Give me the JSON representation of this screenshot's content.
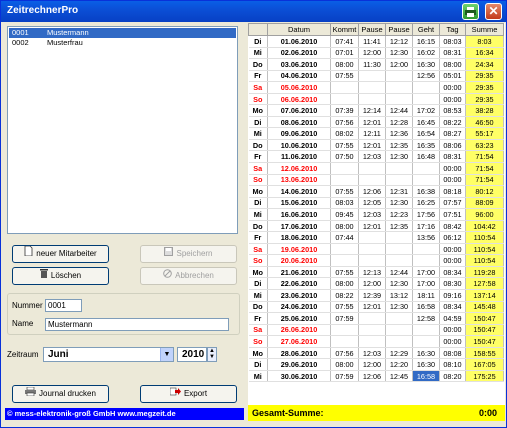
{
  "app": {
    "title": "ZeitrechnerPro",
    "close_glyph": "✕"
  },
  "employees": [
    {
      "number": "0001",
      "name": "Mustermann",
      "selected": true
    },
    {
      "number": "0002",
      "name": "Musterfrau",
      "selected": false
    }
  ],
  "buttons": {
    "new_employee": "neuer Mitarbeiter",
    "save": "Speichern",
    "delete": "Löschen",
    "cancel": "Abbrechen",
    "print_journal": "Journal drucken",
    "export": "Export"
  },
  "form": {
    "number_label": "Nummer",
    "number_value": "0001",
    "name_label": "Name",
    "name_value": "Mustermann",
    "period_label": "Zeitraum",
    "month_value": "Juni",
    "year_value": "2010"
  },
  "footer_left": "© mess-elektronik-groß GmbH   www.megzeit.de",
  "table": {
    "headers": [
      "",
      "Datum",
      "Kommt",
      "Pause",
      "Pause",
      "Geht",
      "Tag",
      "Summe"
    ],
    "rows": [
      [
        "Di",
        "01.06.2010",
        "07:41",
        "11:41",
        "12:12",
        "16:15",
        "08:03",
        "8:03"
      ],
      [
        "Mi",
        "02.06.2010",
        "07:01",
        "12:00",
        "12:30",
        "16:02",
        "08:31",
        "16:34"
      ],
      [
        "Do",
        "03.06.2010",
        "08:00",
        "11:30",
        "12:00",
        "16:30",
        "08:00",
        "24:34"
      ],
      [
        "Fr",
        "04.06.2010",
        "07:55",
        "",
        "",
        "12:56",
        "05:01",
        "29:35"
      ],
      [
        "Sa",
        "05.06.2010",
        "",
        "",
        "",
        "",
        "00:00",
        "29:35"
      ],
      [
        "So",
        "06.06.2010",
        "",
        "",
        "",
        "",
        "00:00",
        "29:35"
      ],
      [
        "Mo",
        "07.06.2010",
        "07:39",
        "12:14",
        "12:44",
        "17:02",
        "08:53",
        "38:28"
      ],
      [
        "Di",
        "08.06.2010",
        "07:56",
        "12:01",
        "12:28",
        "16:45",
        "08:22",
        "46:50"
      ],
      [
        "Mi",
        "09.06.2010",
        "08:02",
        "12:11",
        "12:36",
        "16:54",
        "08:27",
        "55:17"
      ],
      [
        "Do",
        "10.06.2010",
        "07:55",
        "12:01",
        "12:35",
        "16:35",
        "08:06",
        "63:23"
      ],
      [
        "Fr",
        "11.06.2010",
        "07:50",
        "12:03",
        "12:30",
        "16:48",
        "08:31",
        "71:54"
      ],
      [
        "Sa",
        "12.06.2010",
        "",
        "",
        "",
        "",
        "00:00",
        "71:54"
      ],
      [
        "So",
        "13.06.2010",
        "",
        "",
        "",
        "",
        "00:00",
        "71:54"
      ],
      [
        "Mo",
        "14.06.2010",
        "07:55",
        "12:06",
        "12:31",
        "16:38",
        "08:18",
        "80:12"
      ],
      [
        "Di",
        "15.06.2010",
        "08:03",
        "12:05",
        "12:30",
        "16:25",
        "07:57",
        "88:09"
      ],
      [
        "Mi",
        "16.06.2010",
        "09:45",
        "12:03",
        "12:23",
        "17:56",
        "07:51",
        "96:00"
      ],
      [
        "Do",
        "17.06.2010",
        "08:00",
        "12:01",
        "12:35",
        "17:16",
        "08:42",
        "104:42"
      ],
      [
        "Fr",
        "18.06.2010",
        "07:44",
        "",
        "",
        "13:56",
        "06:12",
        "110:54"
      ],
      [
        "Sa",
        "19.06.2010",
        "",
        "",
        "",
        "",
        "00:00",
        "110:54"
      ],
      [
        "So",
        "20.06.2010",
        "",
        "",
        "",
        "",
        "00:00",
        "110:54"
      ],
      [
        "Mo",
        "21.06.2010",
        "07:55",
        "12:13",
        "12:44",
        "17:00",
        "08:34",
        "119:28"
      ],
      [
        "Di",
        "22.06.2010",
        "08:00",
        "12:00",
        "12:30",
        "17:00",
        "08:30",
        "127:58"
      ],
      [
        "Mi",
        "23.06.2010",
        "08:22",
        "12:39",
        "13:12",
        "18:11",
        "09:16",
        "137:14"
      ],
      [
        "Do",
        "24.06.2010",
        "07:55",
        "12:01",
        "12:30",
        "16:58",
        "08:34",
        "145:48"
      ],
      [
        "Fr",
        "25.06.2010",
        "07:59",
        "",
        "",
        "12:58",
        "04:59",
        "150:47"
      ],
      [
        "Sa",
        "26.06.2010",
        "",
        "",
        "",
        "",
        "00:00",
        "150:47"
      ],
      [
        "So",
        "27.06.2010",
        "",
        "",
        "",
        "",
        "00:00",
        "150:47"
      ],
      [
        "Mo",
        "28.06.2010",
        "07:56",
        "12:03",
        "12:29",
        "16:30",
        "08:08",
        "158:55"
      ],
      [
        "Di",
        "29.06.2010",
        "08:00",
        "12:00",
        "12:20",
        "16:30",
        "08:10",
        "167:05"
      ],
      [
        "Mi",
        "30.06.2010",
        "07:59",
        "12:06",
        "12:45",
        "16:58",
        "08:20",
        "175:25"
      ]
    ],
    "weekend_days": [
      "Sa",
      "So"
    ],
    "highlighted_cell": {
      "row": 29,
      "col": 5
    }
  },
  "total": {
    "label": "Gesamt-Summe:",
    "value": "0:00"
  },
  "colors": {
    "title_bar": "#0a5fe6",
    "sum_column": "#ffff66",
    "total_bar": "#ffff00",
    "footer_left_bg": "#0000ff",
    "weekend_text": "#ff0000",
    "selection": "#316ac5"
  },
  "icons": {
    "titlebar_action": "printer-icon",
    "close": "close-icon",
    "new_employee": "document-icon",
    "save": "save-icon",
    "delete": "trash-icon",
    "cancel": "cancel-icon",
    "print": "printer-icon",
    "export": "export-arrow-icon",
    "combo": "chevron-down-icon",
    "spin": "spinner-icon"
  }
}
